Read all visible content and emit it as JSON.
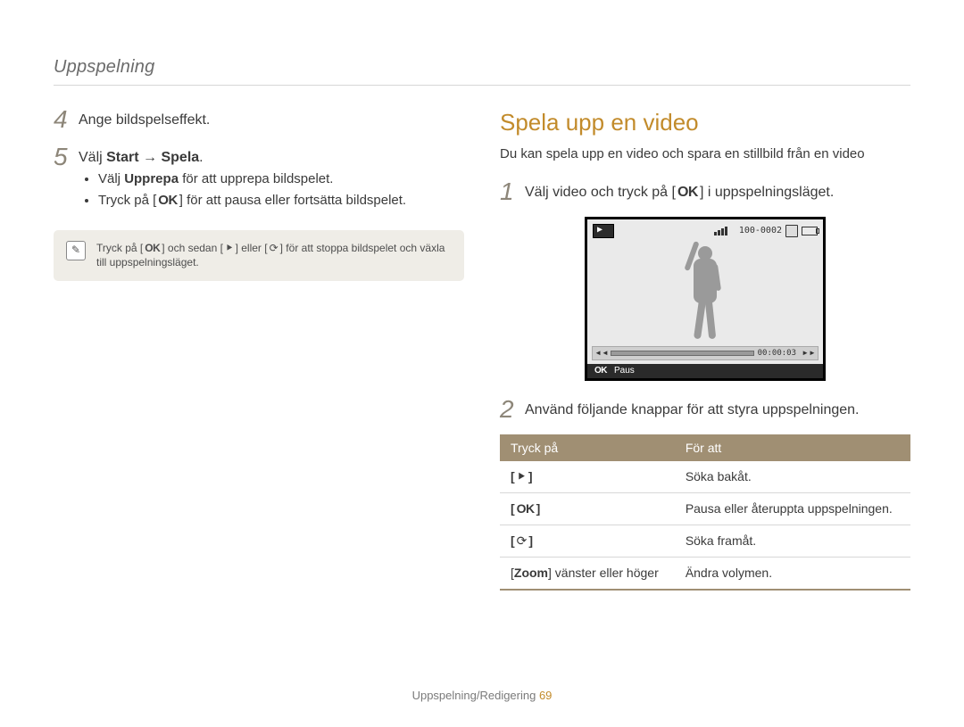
{
  "chapter": "Uppspelning",
  "left": {
    "step4": {
      "num": "4",
      "text": "Ange bildspelseffekt."
    },
    "step5": {
      "num": "5",
      "prefix": "Välj ",
      "bold1": "Start",
      "arrow": " → ",
      "bold2": "Spela",
      "suffix": ".",
      "bullet1_a": "Välj ",
      "bullet1_b": "Upprepa",
      "bullet1_c": " för att upprepa bildspelet.",
      "bullet2_a": "Tryck på [",
      "bullet2_ok": "OK",
      "bullet2_b": "] för att pausa eller fortsätta bildspelet."
    },
    "note": {
      "a": "Tryck på [",
      "ok": "OK",
      "b": "] och sedan [",
      "flash": "⯇",
      "c": "] eller [",
      "timer": "⟳",
      "d": "] för att stoppa bildspelet och växla till uppspelningsläget."
    }
  },
  "right": {
    "heading": "Spela upp en video",
    "lead": "Du kan spela upp en video och spara en stillbild från en video",
    "step1": {
      "num": "1",
      "a": "Välj video och tryck på [",
      "ok": "OK",
      "b": "] i uppspelningsläget."
    },
    "camera": {
      "counter": "100-0002",
      "time": "00:00:03",
      "pause": "Paus",
      "ok": "OK"
    },
    "step2": {
      "num": "2",
      "text": "Använd följande knappar för att styra uppspelningen."
    },
    "table": {
      "h1": "Tryck på",
      "h2": "För att",
      "r1v": "Söka bakåt.",
      "r2v": "Pausa eller återuppta uppspelningen.",
      "r3v": "Söka framåt.",
      "r4k_a": "[",
      "r4k_b": "Zoom",
      "r4k_c": "] vänster eller höger",
      "r4v": "Ändra volymen."
    }
  },
  "footer": {
    "text": "Uppspelning/Redigering ",
    "page": "69"
  },
  "icons": {
    "flash": "⯈",
    "timer": "⟳",
    "rew": "◄◄",
    "fwd": "►►",
    "brL": "[",
    "brR": "]"
  }
}
